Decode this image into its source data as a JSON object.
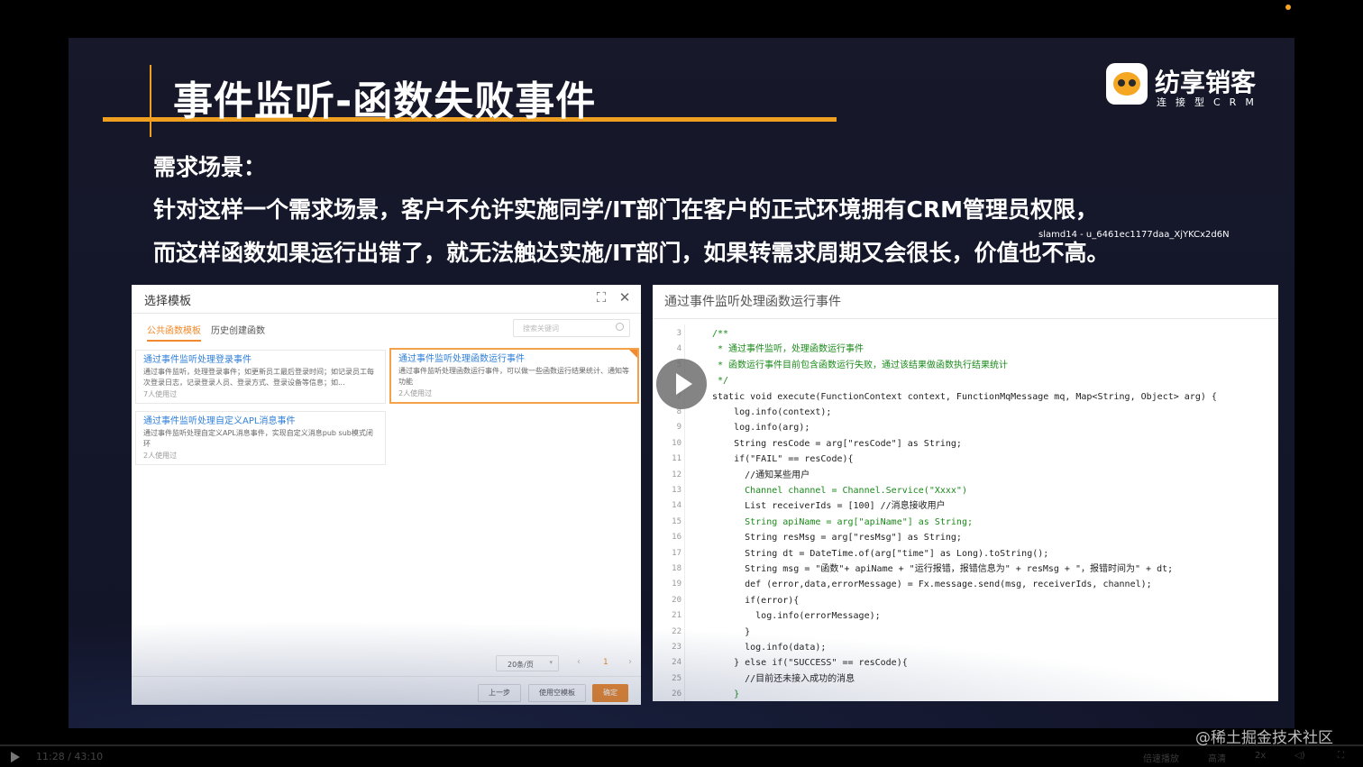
{
  "slide": {
    "title": "事件监听-函数失败事件",
    "logo_name": "纺享销客",
    "logo_sub": "连接型CRM",
    "req_heading": "需求场景：",
    "req_line1": "针对这样一个需求场景，客户不允许实施同学/IT部门在客户的正式环境拥有CRM管理员权限，",
    "req_line2": "而这样函数如果运行出错了，就无法触达实施/IT部门，如果转需求周期又会很长，价值也不高。",
    "watermark": "slamd14 - u_6461ec1177daa_XjYKCx2d6N"
  },
  "dialog": {
    "title": "选择模板",
    "tab_active": "公共函数模板",
    "tab_other": "历史创建函数",
    "search_placeholder": "搜索关键词",
    "templates": [
      {
        "title": "通过事件监听处理登录事件",
        "desc": "通过事件监听，处理登录事件；如更新员工最后登录时间；如记录员工每次登录日志，记录登录人员、登录方式、登录设备等信息；如...",
        "usage": "7人使用过"
      },
      {
        "title": "通过事件监听处理函数运行事件",
        "desc": "通过事件监听处理函数运行事件，可以做一些函数运行结果统计、通知等功能",
        "usage": "2人使用过"
      },
      {
        "title": "通过事件监听处理自定义APL消息事件",
        "desc": "通过事件监听处理自定义APL消息事件，实现自定义消息pub sub模式闭环",
        "usage": "2人使用过"
      }
    ],
    "page_size": "20条/页",
    "page_num": "1",
    "btn_prev": "上一步",
    "btn_blank": "使用空模板",
    "btn_ok": "确定"
  },
  "code": {
    "title": "通过事件监听处理函数运行事件",
    "lines": [
      {
        "n": "3",
        "t": "/**"
      },
      {
        "n": "4",
        "t": " * 通过事件监听，处理函数运行事件"
      },
      {
        "n": "5",
        "t": " * 函数运行事件目前包含函数运行失败，通过该结果做函数执行结果统计"
      },
      {
        "n": "6",
        "t": " */"
      },
      {
        "n": "7",
        "t": "static void execute(FunctionContext context, FunctionMqMessage mq, Map<String, Object> arg) {"
      },
      {
        "n": "8",
        "t": "    log.info(context);"
      },
      {
        "n": "9",
        "t": "    log.info(arg);"
      },
      {
        "n": "10",
        "t": "    String resCode = arg[\"resCode\"] as String;"
      },
      {
        "n": "11",
        "t": "    if(\"FAIL\" == resCode){"
      },
      {
        "n": "12",
        "t": "      //通知某些用户"
      },
      {
        "n": "13",
        "t": "      Channel channel = Channel.Service(\"Xxxx\")"
      },
      {
        "n": "14",
        "t": "      List receiverIds = [100] //消息接收用户"
      },
      {
        "n": "15",
        "t": "      String apiName = arg[\"apiName\"] as String;"
      },
      {
        "n": "16",
        "t": "      String resMsg = arg[\"resMsg\"] as String;"
      },
      {
        "n": "17",
        "t": "      String dt = DateTime.of(arg[\"time\"] as Long).toString();"
      },
      {
        "n": "18",
        "t": "      String msg = \"函数\"+ apiName + \"运行报错，报错信息为\" + resMsg + \"，报错时间为\" + dt;"
      },
      {
        "n": "19",
        "t": "      def (error,data,errorMessage) = Fx.message.send(msg, receiverIds, channel);"
      },
      {
        "n": "20",
        "t": "      if(error){"
      },
      {
        "n": "21",
        "t": "        log.info(errorMessage);"
      },
      {
        "n": "22",
        "t": "      }"
      },
      {
        "n": "23",
        "t": "      log.info(data);"
      },
      {
        "n": "24",
        "t": "    } else if(\"SUCCESS\" == resCode){"
      },
      {
        "n": "25",
        "t": "      //目前还未接入成功的消息"
      },
      {
        "n": "26",
        "t": "    }"
      }
    ]
  },
  "overlay": {
    "juejin": "@稀土掘金技术社区"
  },
  "player": {
    "time": "11:28 / 43:10",
    "ctrl1": "倍速播放",
    "ctrl2": "高清",
    "ctrl3": "2x",
    "ctrl4": "◁)",
    "ctrl5": "⛶"
  },
  "colors": {
    "accent": "#f0a020",
    "tab_active": "#f08a2c",
    "link_blue": "#2f7fd8",
    "comment_green": "#1a8a1a"
  }
}
